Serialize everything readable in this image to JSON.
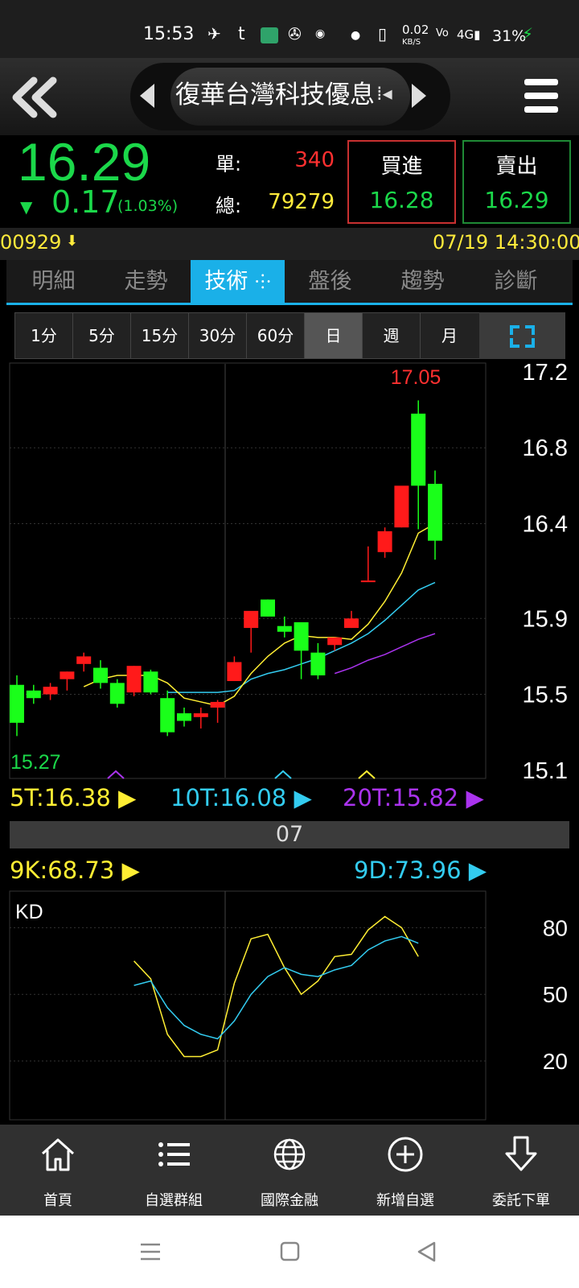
{
  "status_bar": {
    "time": "15:53",
    "net_speed": "0.02",
    "net_unit": "KB/S",
    "battery": "31%"
  },
  "header": {
    "title": "復華台灣科技優息"
  },
  "quote": {
    "price": "16.29",
    "change_arrow": "▼",
    "change": "0.17",
    "change_pct": "(1.03%)",
    "single_label": "單:",
    "single_value": "340",
    "total_label": "總:",
    "total_value": "79279",
    "buy_label": "買進",
    "buy_price": "16.28",
    "sell_label": "賣出",
    "sell_price": "16.29"
  },
  "info": {
    "code": "00929",
    "datetime": "07/19 14:30:00"
  },
  "tabs": [
    {
      "label": "明細"
    },
    {
      "label": "走勢"
    },
    {
      "label": "技術"
    },
    {
      "label": "盤後"
    },
    {
      "label": "趨勢"
    },
    {
      "label": "診斷"
    }
  ],
  "periods": [
    {
      "label": "1分"
    },
    {
      "label": "5分"
    },
    {
      "label": "15分"
    },
    {
      "label": "30分"
    },
    {
      "label": "60分"
    },
    {
      "label": "日"
    },
    {
      "label": "週"
    },
    {
      "label": "月"
    }
  ],
  "colors": {
    "up": "#ff1a1a",
    "down": "#1aff1a",
    "ma5": "#ffee33",
    "ma10": "#33ccf0",
    "ma20": "#aa33ee",
    "accent": "#1ab0e8"
  },
  "chart_data": [
    {
      "type": "candlestick",
      "title": "",
      "y_ticks": [
        "17.2",
        "16.8",
        "16.4",
        "15.9",
        "15.5",
        "15.1"
      ],
      "ylim": [
        15.1,
        17.2
      ],
      "high_label": "17.05",
      "low_label": "15.27",
      "x_label": "07",
      "candles": [
        {
          "o": 15.55,
          "h": 15.6,
          "l": 15.28,
          "c": 15.35
        },
        {
          "o": 15.52,
          "h": 15.55,
          "l": 15.45,
          "c": 15.48
        },
        {
          "o": 15.5,
          "h": 15.56,
          "l": 15.47,
          "c": 15.54
        },
        {
          "o": 15.58,
          "h": 15.62,
          "l": 15.52,
          "c": 15.62
        },
        {
          "o": 15.66,
          "h": 15.72,
          "l": 15.62,
          "c": 15.7
        },
        {
          "o": 15.64,
          "h": 15.68,
          "l": 15.53,
          "c": 15.56
        },
        {
          "o": 15.56,
          "h": 15.58,
          "l": 15.43,
          "c": 15.45
        },
        {
          "o": 15.51,
          "h": 15.65,
          "l": 15.49,
          "c": 15.65
        },
        {
          "o": 15.62,
          "h": 15.63,
          "l": 15.5,
          "c": 15.51
        },
        {
          "o": 15.48,
          "h": 15.52,
          "l": 15.28,
          "c": 15.3
        },
        {
          "o": 15.4,
          "h": 15.43,
          "l": 15.33,
          "c": 15.36
        },
        {
          "o": 15.38,
          "h": 15.43,
          "l": 15.32,
          "c": 15.4
        },
        {
          "o": 15.43,
          "h": 15.47,
          "l": 15.35,
          "c": 15.46
        },
        {
          "o": 15.57,
          "h": 15.7,
          "l": 15.57,
          "c": 15.67
        },
        {
          "o": 15.85,
          "h": 15.93,
          "l": 15.72,
          "c": 15.94
        },
        {
          "o": 16.0,
          "h": 16.0,
          "l": 15.91,
          "c": 15.91
        },
        {
          "o": 15.86,
          "h": 15.91,
          "l": 15.8,
          "c": 15.83
        },
        {
          "o": 15.88,
          "h": 15.88,
          "l": 15.58,
          "c": 15.73
        },
        {
          "o": 15.72,
          "h": 15.77,
          "l": 15.58,
          "c": 15.6
        },
        {
          "o": 15.76,
          "h": 15.8,
          "l": 15.73,
          "c": 15.8
        },
        {
          "o": 15.85,
          "h": 15.94,
          "l": 15.85,
          "c": 15.9
        },
        {
          "o": 16.1,
          "h": 16.28,
          "l": 16.1,
          "c": 16.1
        },
        {
          "o": 16.25,
          "h": 16.38,
          "l": 16.22,
          "c": 16.36
        },
        {
          "o": 16.38,
          "h": 16.59,
          "l": 16.38,
          "c": 16.6
        },
        {
          "o": 16.98,
          "h": 17.05,
          "l": 16.37,
          "c": 16.6
        },
        {
          "o": 16.61,
          "h": 16.68,
          "l": 16.21,
          "c": 16.31
        }
      ],
      "series": [
        {
          "name": "5T",
          "last": "16.38",
          "values": [
            null,
            null,
            null,
            null,
            15.54,
            15.58,
            15.6,
            15.6,
            15.6,
            15.56,
            15.48,
            15.46,
            15.44,
            15.49,
            15.61,
            15.7,
            15.77,
            15.81,
            15.8,
            15.8,
            15.79,
            15.87,
            15.99,
            16.14,
            16.35,
            16.4
          ]
        },
        {
          "name": "10T",
          "last": "16.08",
          "values": [
            null,
            null,
            null,
            null,
            null,
            null,
            null,
            null,
            null,
            15.51,
            15.51,
            15.51,
            15.51,
            15.52,
            15.58,
            15.61,
            15.63,
            15.66,
            15.69,
            15.73,
            15.77,
            15.82,
            15.89,
            15.97,
            16.05,
            16.09
          ]
        },
        {
          "name": "20T",
          "last": "15.82",
          "values": [
            null,
            null,
            null,
            null,
            null,
            null,
            null,
            null,
            null,
            null,
            null,
            null,
            null,
            null,
            null,
            null,
            null,
            null,
            null,
            15.61,
            15.64,
            15.68,
            15.71,
            15.75,
            15.79,
            15.82
          ]
        }
      ]
    },
    {
      "type": "line",
      "title": "KD",
      "y_ticks": [
        "80",
        "50",
        "20"
      ],
      "ylim": [
        0,
        100
      ],
      "series": [
        {
          "name": "9K",
          "last": "68.73",
          "values": [
            null,
            null,
            null,
            null,
            null,
            null,
            null,
            65,
            57,
            32,
            22,
            22,
            25,
            55,
            75,
            77,
            62,
            50,
            56,
            67,
            68,
            79,
            85,
            80,
            67
          ]
        },
        {
          "name": "9D",
          "last": "73.96",
          "values": [
            null,
            null,
            null,
            null,
            null,
            null,
            null,
            54,
            56,
            44,
            36,
            32,
            30,
            38,
            50,
            58,
            62,
            59,
            58,
            61,
            63,
            70,
            74,
            76,
            73
          ]
        }
      ]
    }
  ],
  "bottom_nav": [
    {
      "label": "首頁",
      "icon": "home-icon"
    },
    {
      "label": "自選群組",
      "icon": "list-icon"
    },
    {
      "label": "國際金融",
      "icon": "globe-icon"
    },
    {
      "label": "新增自選",
      "icon": "add-circle-icon"
    },
    {
      "label": "委託下單",
      "icon": "order-arrow-icon"
    }
  ]
}
